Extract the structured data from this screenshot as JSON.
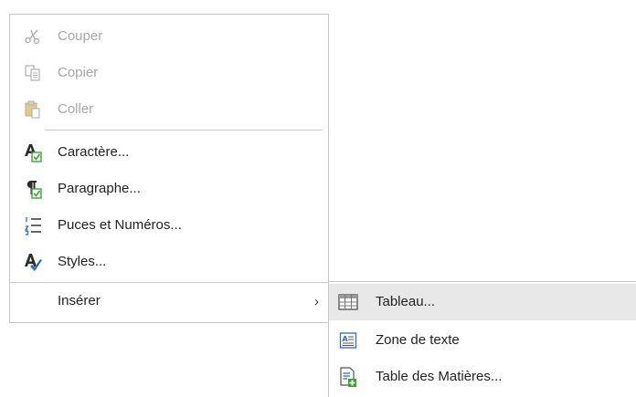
{
  "context_menu": {
    "items": [
      {
        "label": "Couper",
        "icon": "scissors-icon",
        "disabled": true
      },
      {
        "label": "Copier",
        "icon": "copy-icon",
        "disabled": true
      },
      {
        "label": "Coller",
        "icon": "paste-icon",
        "disabled": true
      },
      {
        "label": "Caractère...",
        "icon": "character-format-icon",
        "disabled": false
      },
      {
        "label": "Paragraphe...",
        "icon": "paragraph-format-icon",
        "disabled": false
      },
      {
        "label": "Puces et Numéros...",
        "icon": "bullets-numbering-icon",
        "disabled": false
      },
      {
        "label": "Styles...",
        "icon": "styles-icon",
        "disabled": false
      },
      {
        "label": "Insérer",
        "icon": "",
        "disabled": false,
        "submenu_indicator": "›"
      }
    ]
  },
  "submenu": {
    "items": [
      {
        "label": "Tableau...",
        "icon": "table-icon",
        "highlighted": true
      },
      {
        "label": "Zone de texte",
        "icon": "text-box-icon",
        "highlighted": false
      },
      {
        "label": "Table des Matières...",
        "icon": "table-of-contents-icon",
        "highlighted": false
      }
    ]
  },
  "colors": {
    "accent_green": "#3aa335",
    "icon_blue": "#2f6db5",
    "disabled_gray": "#a7a7a7",
    "highlight": "#e8e8e8"
  }
}
